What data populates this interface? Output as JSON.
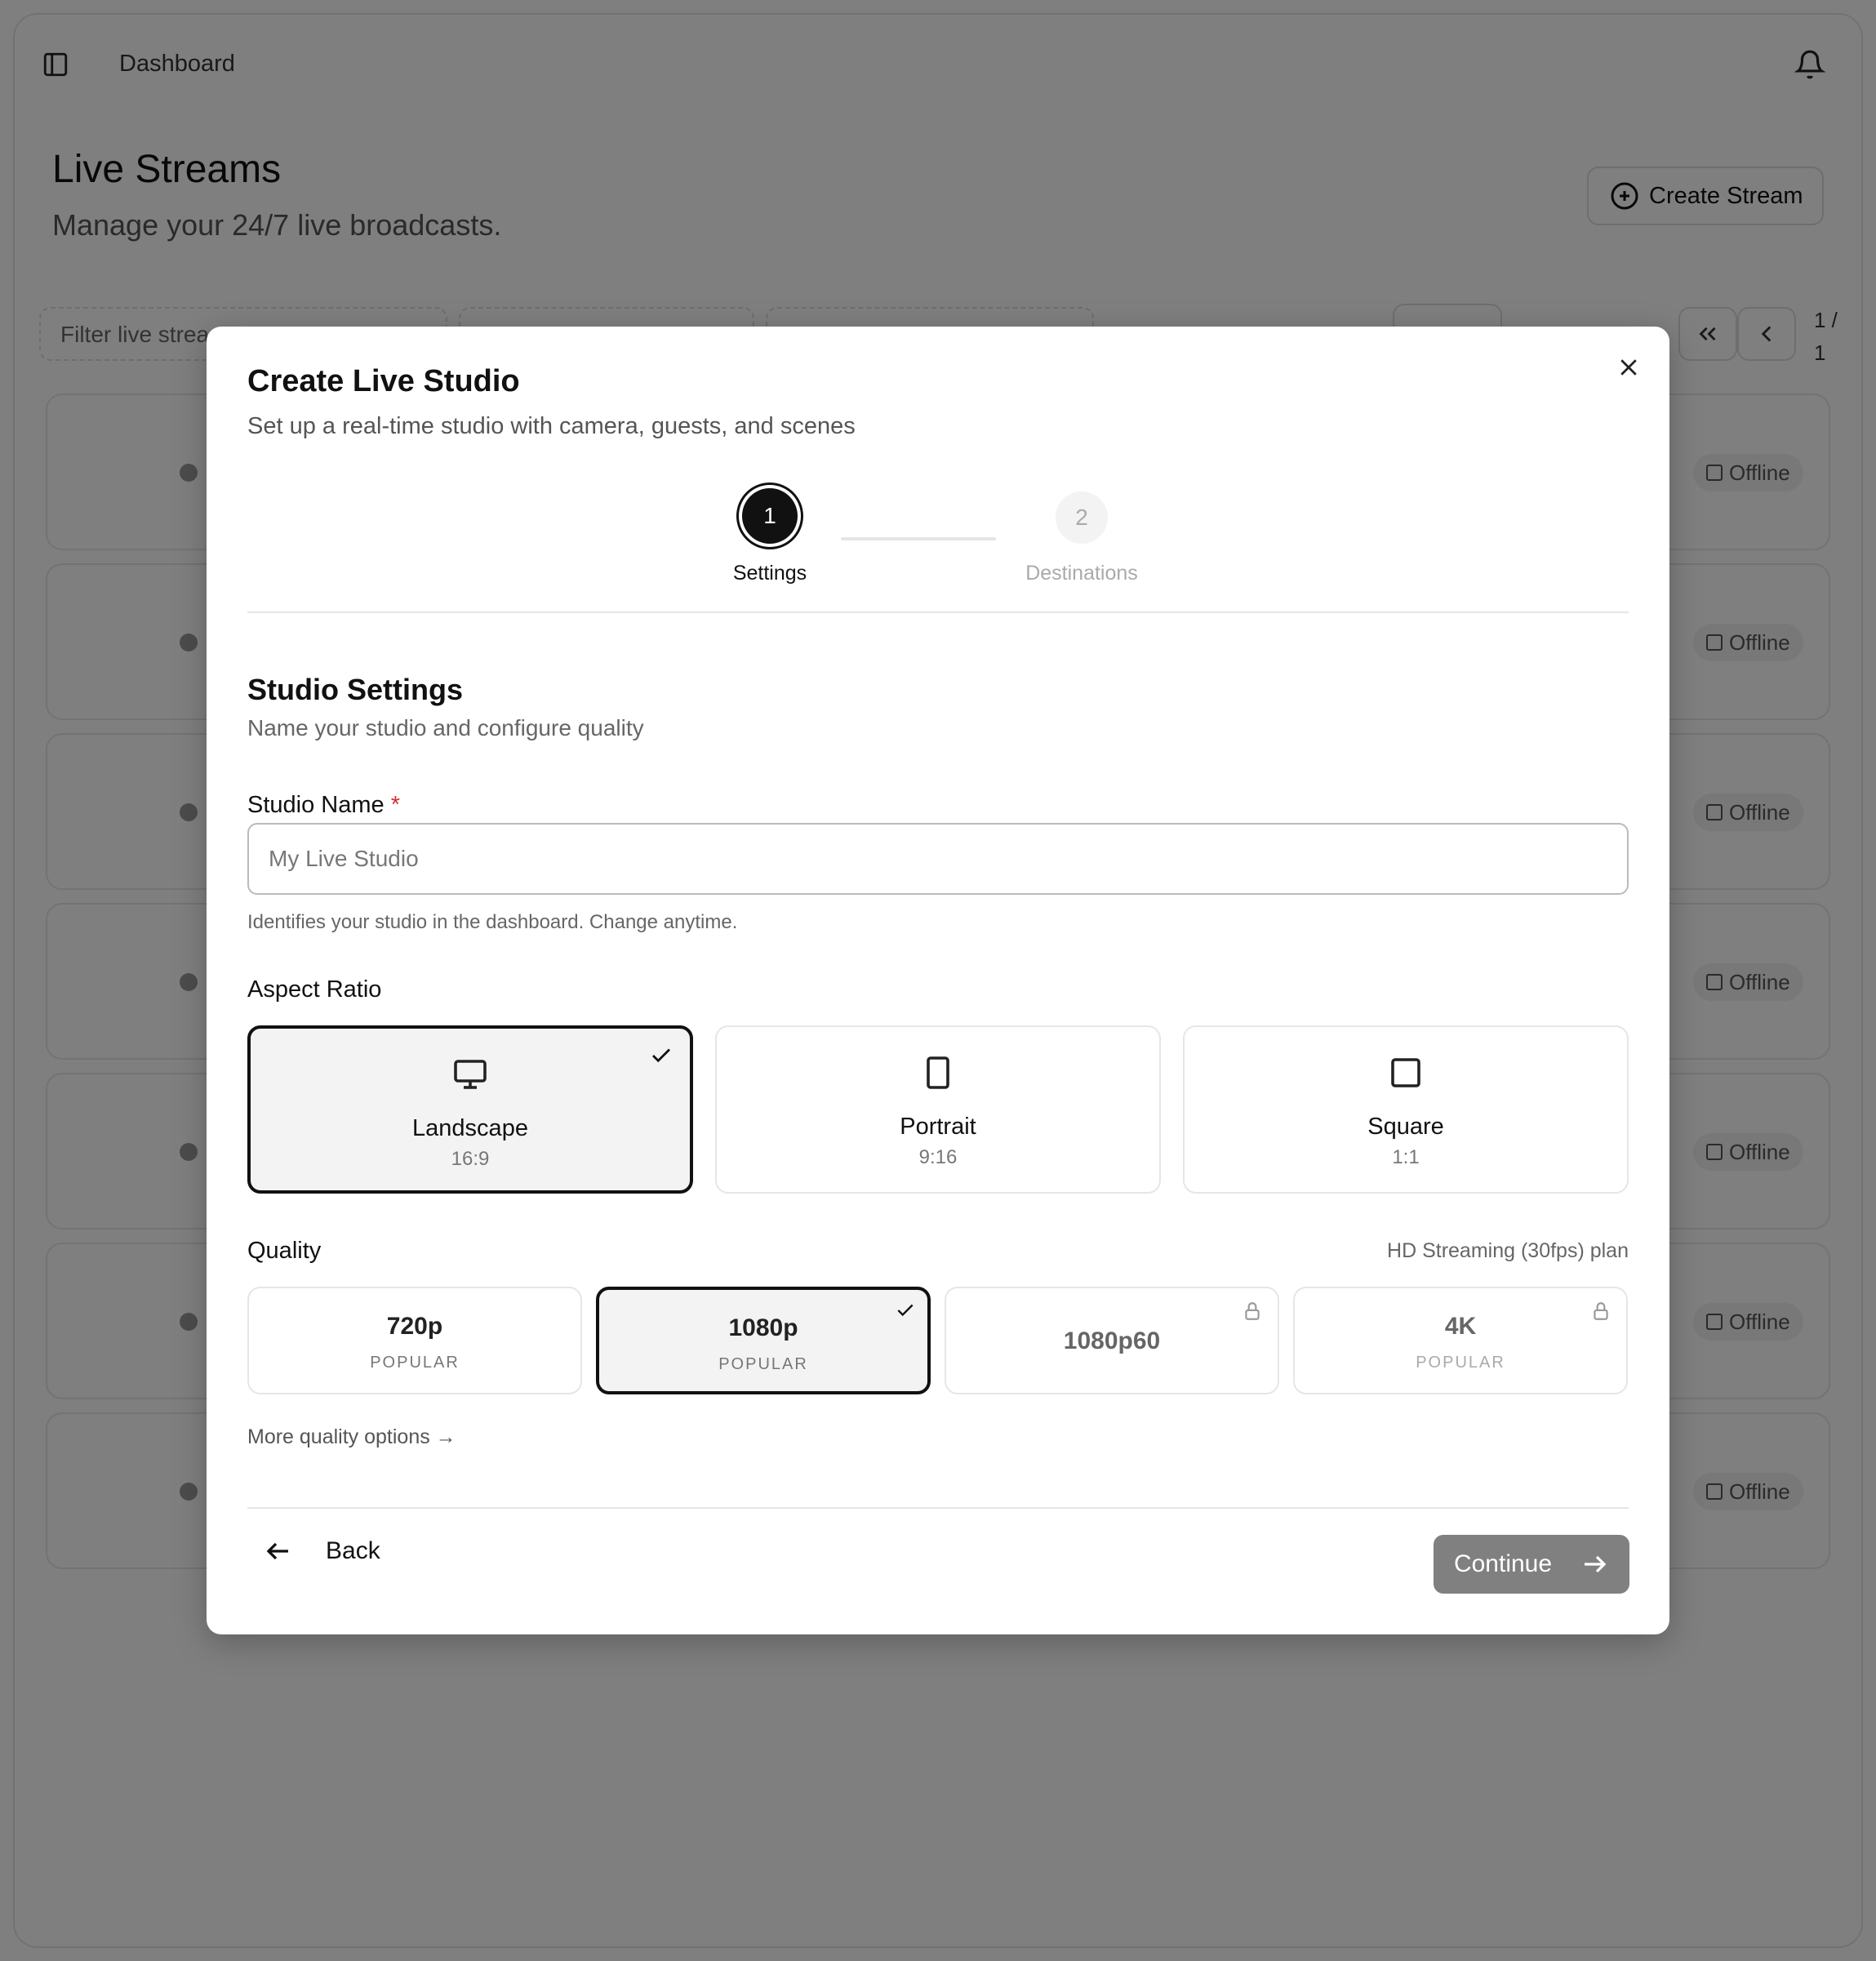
{
  "app": {
    "breadcrumb": "Dashboard",
    "page_title": "Live Streams",
    "page_subtitle": "Manage your 24/7 live broadcasts.",
    "create_button": "Create Stream",
    "filter_placeholder": "Filter live strea",
    "pagination_label": "1 / 1",
    "row_status": "Offline",
    "row_count": 7
  },
  "modal": {
    "title": "Create Live Studio",
    "subtitle": "Set up a real-time studio with camera, guests, and scenes",
    "steps": [
      {
        "number": "1",
        "label": "Settings",
        "active": true
      },
      {
        "number": "2",
        "label": "Destinations",
        "active": false
      }
    ],
    "section_title": "Studio Settings",
    "section_subtitle": "Name your studio and configure quality",
    "studio_name": {
      "label": "Studio Name",
      "required_mark": "*",
      "value": "",
      "placeholder": "My Live Studio",
      "help": "Identifies your studio in the dashboard. Change anytime."
    },
    "aspect_ratio": {
      "label": "Aspect Ratio",
      "options": [
        {
          "name": "Landscape",
          "ratio": "16:9",
          "icon": "monitor-icon",
          "selected": true
        },
        {
          "name": "Portrait",
          "ratio": "9:16",
          "icon": "tablet-portrait-icon",
          "selected": false
        },
        {
          "name": "Square",
          "ratio": "1:1",
          "icon": "square-icon",
          "selected": false
        }
      ]
    },
    "quality": {
      "label": "Quality",
      "plan": "HD Streaming (30fps) plan",
      "options": [
        {
          "name": "720p",
          "tag": "POPULAR",
          "selected": false,
          "locked": false
        },
        {
          "name": "1080p",
          "tag": "POPULAR",
          "selected": true,
          "locked": false
        },
        {
          "name": "1080p60",
          "tag": "",
          "selected": false,
          "locked": true
        },
        {
          "name": "4K",
          "tag": "POPULAR",
          "selected": false,
          "locked": true
        }
      ],
      "more_link": "More quality options →"
    },
    "back_button": "Back",
    "continue_button": "Continue"
  },
  "colors": {
    "primary": "#111111",
    "overlay": "rgba(0,0,0,0.5)",
    "required": "#d32f2f",
    "disabled_button": "#808080"
  }
}
